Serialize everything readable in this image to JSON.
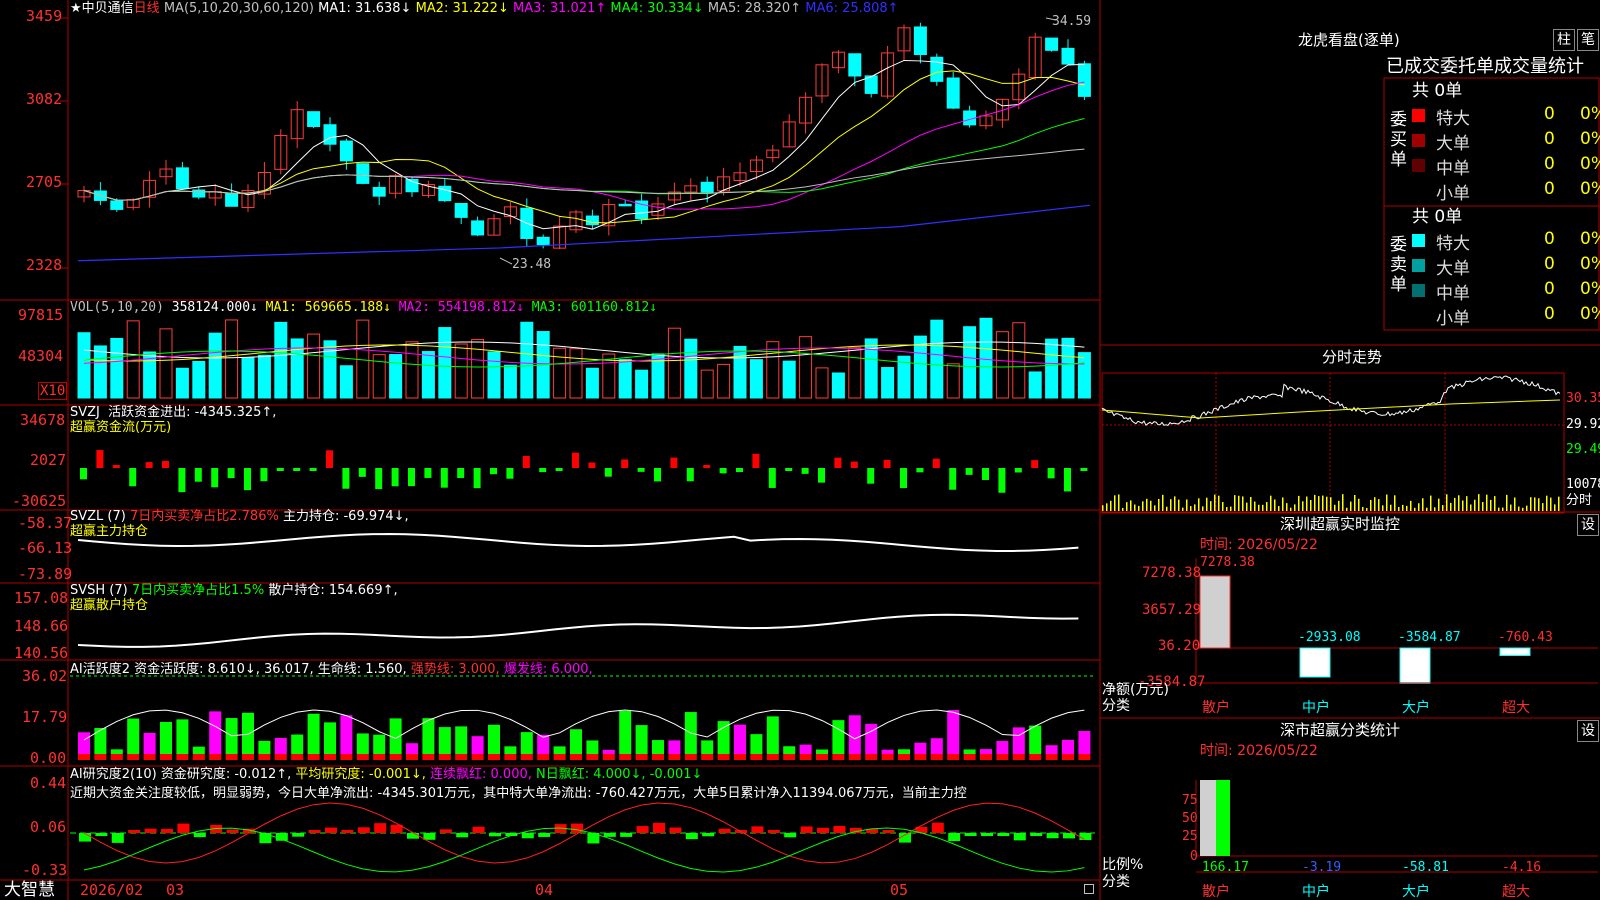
{
  "stock": {
    "name": "中贝通信",
    "period": "日线"
  },
  "colors": {
    "up": "#ff3b3b",
    "down": "#00ffff",
    "ma1": "#ffffff",
    "ma2": "#ffff00",
    "ma3": "#ff00ff",
    "ma4": "#00ff00",
    "ma5": "#c0c0c0",
    "ma6": "#3030ff",
    "grid": "#b00000"
  },
  "main": {
    "indicator": "MA(5,10,20,30,60,120)",
    "ma1": "MA1: 31.638↓",
    "ma2": "MA2: 31.222↓",
    "ma3": "MA3: 31.021↑",
    "ma4": "MA4: 30.334↓",
    "ma5": "MA5: 28.320↑",
    "ma6": "MA6: 25.808↑",
    "y_ticks": [
      "3459",
      "3082",
      "2705",
      "2328"
    ],
    "high_label": "34.59",
    "low_label": "23.48"
  },
  "vol": {
    "indicator": "VOL(5,10,20)",
    "value": "358124.000↓",
    "ma1": "MA1: 569665.188↓",
    "ma2": "MA2: 554198.812↓",
    "ma3": "MA3: 601160.812↓",
    "y_ticks": [
      "97815",
      "48304"
    ],
    "unit": "X10"
  },
  "svzj": {
    "name": "SVZJ",
    "label": "活跃资金进出: -4345.325↑,",
    "sub": "超赢资金流(万元)",
    "y_ticks": [
      "34678",
      "2027",
      "-30625"
    ]
  },
  "svzl": {
    "name": "SVZL (7)",
    "pct": "7日内买卖净占比2.786%",
    "label": "主力持仓: -69.974↓,",
    "sub": "超赢主力持仓",
    "y_ticks": [
      "-58.37",
      "-66.13",
      "-73.89"
    ]
  },
  "svsh": {
    "name": "SVSH (7)",
    "pct": "7日内买卖净占比1.5%",
    "label": "散户持仓: 154.669↑,",
    "sub": "超赢散户持仓",
    "y_ticks": [
      "157.08",
      "148.66",
      "140.56"
    ]
  },
  "ai1": {
    "name": "AI活跃度2",
    "label": "资金活跃度: 8.610↓, 36.017,",
    "life": "生命线: 1.560,",
    "strong": "强势线: 3.000,",
    "burst": "爆发线: 6.000,",
    "y_ticks": [
      "36.02",
      "17.79",
      "0.00"
    ]
  },
  "ai2": {
    "name": "AI研究度2(10)",
    "label": "资金研究度: -0.012↑,",
    "avg": "平均研究度: -0.001↓,",
    "red": "连续飘红: 0.000,",
    "nred": "N日飘红: 4.000↓, -0.001↓",
    "text": "近期大资金关注度较低，明显弱势，今日大单净流出: -4345.301万元，其中特大单净流出: -760.427万元，大单5日累计净入11394.067万元，当前主力控",
    "y_ticks": [
      "0.44",
      "0.06",
      "-0.33"
    ]
  },
  "footer": {
    "logo": "大智慧",
    "dates": [
      "2026/02",
      "03",
      "04",
      "05"
    ]
  },
  "lhb": {
    "title": "龙虎看盘(逐单)",
    "btn1": "柱",
    "btn2": "笔",
    "tabs": "已成交委托单成交量统计",
    "buy_side": "委买单",
    "sell_side": "委卖单",
    "buy_total": "共 0单",
    "sell_total": "共 0单",
    "buy_rows": [
      {
        "label": "特大",
        "count": "0",
        "pct": "0%",
        "color": "#ff0000"
      },
      {
        "label": "大单",
        "count": "0",
        "pct": "0%",
        "color": "#a00000"
      },
      {
        "label": "中单",
        "count": "0",
        "pct": "0%",
        "color": "#600000"
      },
      {
        "label": "小单",
        "count": "0",
        "pct": "0%",
        "color": "#000000"
      }
    ],
    "sell_rows": [
      {
        "label": "特大",
        "count": "0",
        "pct": "0%",
        "color": "#00ffff"
      },
      {
        "label": "大单",
        "count": "0",
        "pct": "0%",
        "color": "#00a0a0"
      },
      {
        "label": "中单",
        "count": "0",
        "pct": "0%",
        "color": "#007070"
      },
      {
        "label": "小单",
        "count": "0",
        "pct": "0%",
        "color": "#000000"
      }
    ]
  },
  "fenshi": {
    "title": "分时走势",
    "y_ticks": [
      "30.35",
      "29.92",
      "29.49"
    ],
    "vol_tick": "10078",
    "unit": "分时"
  },
  "sz_monitor": {
    "title": "深圳超赢实时监控",
    "set": "设",
    "time": "时间: 2026/05/22",
    "y_ticks": [
      "7278.38",
      "3657.29",
      "36.20",
      "-3584.87"
    ],
    "top_value": "7278.38",
    "unit": "净额(万元)",
    "cat_label": "分类",
    "categories": [
      "散户",
      "中户",
      "大户",
      "超大"
    ],
    "values": [
      7278.38,
      -2933.08,
      -3584.87,
      -760.43
    ],
    "value_labels": [
      "",
      "-2933.08",
      "-3584.87",
      "-760.43"
    ]
  },
  "sz_stats": {
    "title": "深市超赢分类统计",
    "set": "设",
    "time": "时间: 2026/05/22",
    "y_ticks": [
      "75",
      "50",
      "25",
      "0"
    ],
    "unit": "比例%",
    "cat_label": "分类",
    "categories": [
      "散户",
      "中户",
      "大户",
      "超大"
    ],
    "values": [
      166.17,
      -3.19,
      -58.81,
      -4.16
    ],
    "value_labels": [
      "166.17",
      "-3.19",
      "-58.81",
      "-4.16"
    ]
  }
}
